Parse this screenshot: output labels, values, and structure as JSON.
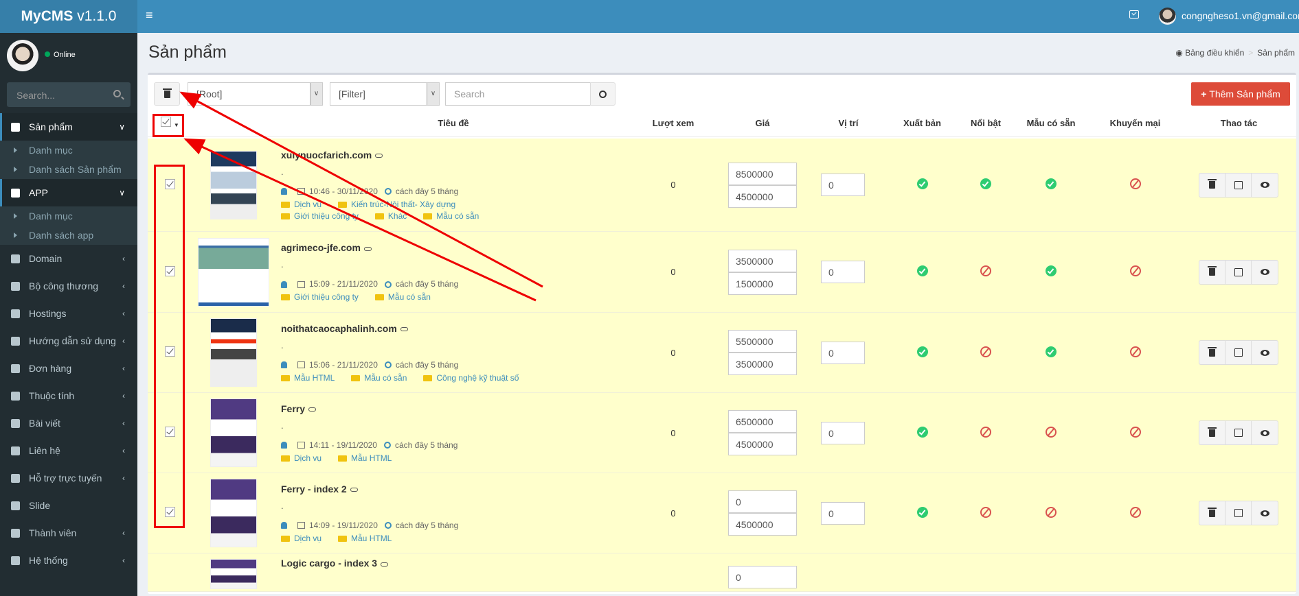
{
  "app": {
    "logo_bold": "MyCMS",
    "logo_version": " v1.1.0",
    "user_email": "congngheso1.vn@gmail.com",
    "status": "Online",
    "search_placeholder": "Search..."
  },
  "sidebar": {
    "items": [
      {
        "label": "Sản phẩm",
        "active": true,
        "icon": "cube-icon",
        "children": [
          "Danh mục",
          "Danh sách Sản phẩm"
        ]
      },
      {
        "label": "APP",
        "active": true,
        "icon": "cube-icon",
        "children": [
          "Danh mục",
          "Danh sách app"
        ]
      },
      {
        "label": "Domain",
        "icon": "cube-icon"
      },
      {
        "label": "Bộ công thương",
        "icon": "cube-icon"
      },
      {
        "label": "Hostings",
        "icon": "cube-icon"
      },
      {
        "label": "Hướng dẫn sử dụng",
        "icon": "cube-icon"
      },
      {
        "label": "Đơn hàng",
        "icon": "cart-icon"
      },
      {
        "label": "Thuộc tính",
        "icon": "expand-icon"
      },
      {
        "label": "Bài viết",
        "icon": "file-icon"
      },
      {
        "label": "Liên hệ",
        "icon": "calendar-icon"
      },
      {
        "label": "Hỗ trợ trực tuyến",
        "icon": "lifebuoy-icon"
      },
      {
        "label": "Slide",
        "icon": "image-icon",
        "nochev": true
      },
      {
        "label": "Thành viên",
        "icon": "users-icon"
      },
      {
        "label": "Hệ thống",
        "icon": "gear-icon"
      }
    ]
  },
  "page": {
    "title": "Sản phẩm",
    "breadcrumb": [
      "Bảng điều khiển",
      "Sản phẩm"
    ]
  },
  "toolbar": {
    "category_select": "[Root]",
    "filter_select": "[Filter]",
    "search_placeholder": "Search",
    "add_label": "Thêm Sản phẩm"
  },
  "table": {
    "headers": [
      "Tiêu đề",
      "Lượt xem",
      "Giá",
      "Vị trí",
      "Xuất bản",
      "Nổi bật",
      "Mẫu có sẵn",
      "Khuyến mại",
      "Thao tác"
    ],
    "rows": [
      {
        "title": "xulynuocfarich.com",
        "desc": ".",
        "time": "10:46 - 30/11/2020",
        "ago": "cách đây 5 tháng",
        "tags": [
          "Dịch vụ",
          "Kiến trúc-Nội thất- Xây dựng",
          "Giới thiệu công ty",
          "Khác",
          "Mẫu có sẵn"
        ],
        "views": "0",
        "price": "8500000",
        "sale_price": "4500000",
        "position": "0",
        "published": true,
        "featured": true,
        "template": true,
        "promo": false,
        "checked": true
      },
      {
        "title": "agrimeco-jfe.com",
        "desc": ".",
        "time": "15:09 - 21/11/2020",
        "ago": "cách đây 5 tháng",
        "tags": [
          "Giới thiệu công ty",
          "Mẫu có sẵn"
        ],
        "views": "0",
        "price": "3500000",
        "sale_price": "1500000",
        "position": "0",
        "published": true,
        "featured": false,
        "template": true,
        "promo": false,
        "checked": true
      },
      {
        "title": "noithatcaocaphalinh.com",
        "desc": ".",
        "time": "15:06 - 21/11/2020",
        "ago": "cách đây 5 tháng",
        "tags": [
          "Mẫu HTML",
          "Mẫu có sẵn",
          "Công nghệ kỹ thuật số"
        ],
        "views": "0",
        "price": "5500000",
        "sale_price": "3500000",
        "position": "0",
        "published": true,
        "featured": false,
        "template": true,
        "promo": false,
        "checked": true
      },
      {
        "title": "Ferry",
        "desc": ".",
        "time": "14:11 - 19/11/2020",
        "ago": "cách đây 5 tháng",
        "tags": [
          "Dịch vụ",
          "Mẫu HTML"
        ],
        "views": "0",
        "price": "6500000",
        "sale_price": "4500000",
        "position": "0",
        "published": true,
        "featured": false,
        "template": false,
        "promo": false,
        "checked": true
      },
      {
        "title": "Ferry - index 2",
        "desc": ".",
        "time": "14:09 - 19/11/2020",
        "ago": "cách đây 5 tháng",
        "tags": [
          "Dịch vụ",
          "Mẫu HTML"
        ],
        "views": "0",
        "price": "0",
        "sale_price": "4500000",
        "position": "0",
        "published": true,
        "featured": false,
        "template": false,
        "promo": false,
        "checked": true
      },
      {
        "title": "Logic cargo - index 3",
        "price": "0",
        "partial": true
      }
    ]
  },
  "colors": {
    "header": "#3c8dbc",
    "sidebar": "#222d32",
    "add_button": "#dd4b39",
    "row_highlight": "#ffffcc",
    "annotation": "#ee0000"
  }
}
